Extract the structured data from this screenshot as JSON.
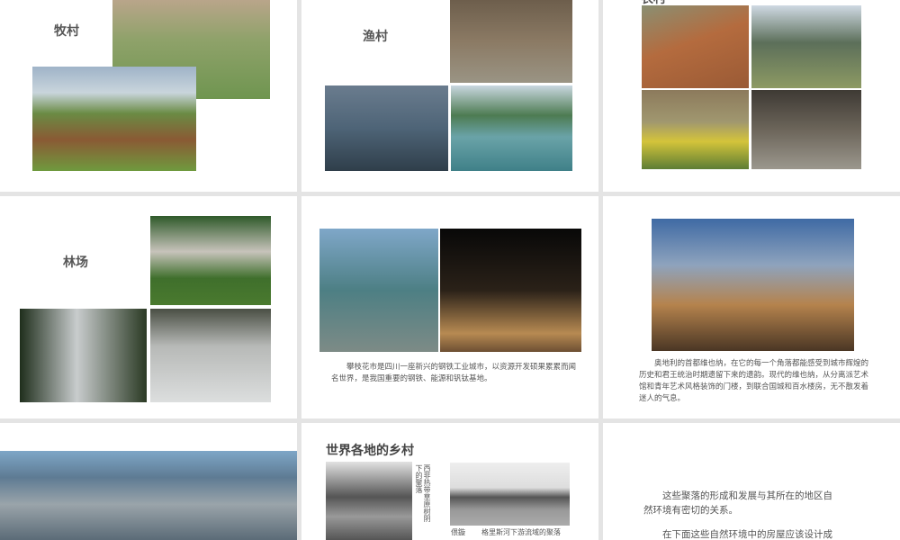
{
  "slides": [
    {
      "title": "牧村"
    },
    {
      "title": "渔村"
    },
    {
      "title": "农村"
    },
    {
      "title": "林场"
    },
    {
      "caption": "攀枝花市是四川一座新兴的钢铁工业城市，以资源开发硕果累累而闻名世界，是我国重要的钢铁、能源和钒钛基地。"
    },
    {
      "caption": "奥地利的首都维也纳，在它的每一个角落都能感受到城市辉煌的历史和君王统治时期遗留下来的遗韵。现代的维也纳，从分离派艺术馆和青年艺术风格装饰的门楼，到联合国城和百水楼房，无不散发着迷人的气息。"
    },
    {},
    {
      "title": "世界各地的乡村",
      "photo1_caption": "西非热带草原树阴下的聚落",
      "photo2_label": "偎鏇",
      "photo2_caption": "格里斯河下游流域的聚落"
    },
    {
      "para1": "这些聚落的形成和发展与其所在的地区自然环境有密切的关系。",
      "para2": "在下面这些自然环境中的房屋应该设计成"
    }
  ]
}
